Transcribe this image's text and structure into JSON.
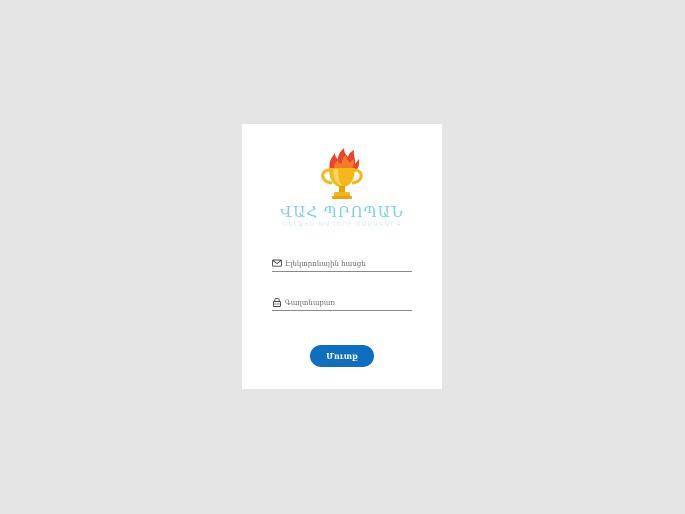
{
  "logo": {
    "title": "ՎԱՀ ՊՐՈՊԱՆ",
    "subtitle": "ՕՆԼԱՅՆ ԽԱՂԵՐԻ ՀԱՄԱԿԱՐԳ",
    "colors": {
      "title": "#7fd0ee",
      "trophy": "#f5b81c",
      "flame": "#e8452c"
    }
  },
  "form": {
    "email": {
      "icon": "envelope-icon",
      "placeholder": "Էլեկտրոնային հասցե",
      "value": ""
    },
    "password": {
      "icon": "lock-icon",
      "placeholder": "Գաղտնաբառ",
      "value": ""
    },
    "submit_label": "Մուտք"
  },
  "colors": {
    "background": "#e5e5e5",
    "card": "#ffffff",
    "button": "#0e6fc1"
  }
}
